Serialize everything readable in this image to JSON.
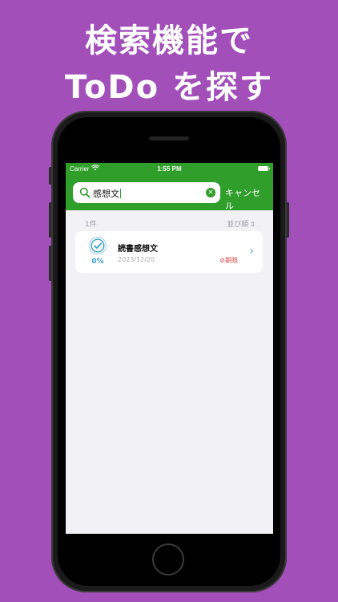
{
  "headline": {
    "line1": "検索機能で",
    "line2": "ToDo を探す"
  },
  "status_bar": {
    "carrier": "Carrier",
    "time": "1:55 PM"
  },
  "search": {
    "value": "感想文",
    "cancel_label": "キャンセル"
  },
  "results": {
    "count": "1件",
    "sort_label": "並び順"
  },
  "todos": [
    {
      "title": "読書感想文",
      "date": "2023/12/20",
      "progress": "0%",
      "status": "期限"
    }
  ],
  "colors": {
    "background": "#a24fba",
    "accent_green": "#2f9e2a",
    "progress_blue": "#3aa0c8",
    "overdue_red": "#e04848"
  }
}
